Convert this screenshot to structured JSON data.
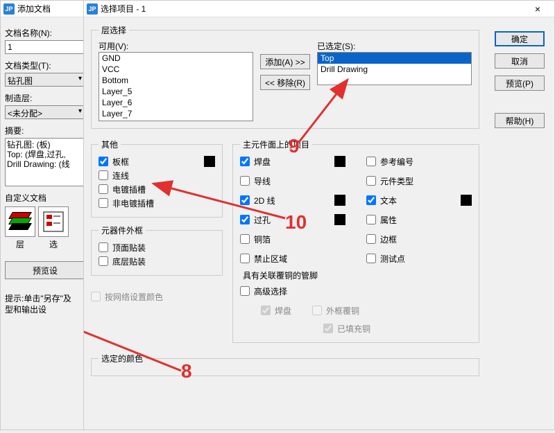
{
  "win_add": {
    "title": "添加文档",
    "name_label": "文档名称(N):",
    "name_value": "1",
    "type_label": "文档类型(T):",
    "type_value": "钻孔图",
    "mfg_label": "制造层:",
    "mfg_value": "<未分配>",
    "summary_label": "摘要:",
    "summary_lines": [
      "钻孔图: (板)",
      "Top: (焊盘,过孔,",
      "Drill Drawing: (线"
    ],
    "custom_label": "自定义文档",
    "layer_btn_label": "层",
    "opt_btn_label": "选",
    "preview_btn": "预览设",
    "tip": "提示:单击\"另存\"及\n        型和输出设"
  },
  "win_sel": {
    "title": "选择项目 - 1",
    "close": "×",
    "layer_group": "层选择",
    "available_label": "可用(V):",
    "available_items": [
      "GND",
      "VCC",
      "Bottom",
      "Layer_5",
      "Layer_6",
      "Layer_7"
    ],
    "add_btn": "添加(A) >>",
    "remove_btn": "<< 移除(R)",
    "selected_label": "已选定(S):",
    "selected_items": [
      "Top",
      "Drill Drawing"
    ],
    "other_group": "其他",
    "other_items": {
      "board_outline": "板框",
      "connections": "连线",
      "plated_slots": "电镀插槽",
      "nonplated_slots": "非电镀插槽"
    },
    "compframe_group": "元器件外框",
    "comp_top": "顶面贴装",
    "comp_bot": "底层贴装",
    "primary_group": "主元件面上的项目",
    "prim_col1": {
      "pads": "焊盘",
      "traces": "导线",
      "lines2d": "2D 线",
      "vias": "过孔",
      "copper": "铜箔",
      "keepout": "禁止区域"
    },
    "prim_col2": {
      "refdes": "参考编号",
      "parttype": "元件类型",
      "text": "文本",
      "attrs": "属性",
      "outline": "边框",
      "testpt": "测试点"
    },
    "assoc_group": "具有关联覆铜的管脚",
    "advanced": "高级选择",
    "assoc_pads": "焊盘",
    "assoc_outer": "外框覆铜",
    "assoc_filled": "已填充铜",
    "bynet": "按网络设置颜色",
    "selcolor_group": "选定的颜色",
    "ok_btn": "确定",
    "cancel_btn": "取消",
    "preview_btn": "预览(P)",
    "help_btn": "帮助(H)"
  },
  "annotations": {
    "n8": "8",
    "n9": "9",
    "n10": "10"
  }
}
